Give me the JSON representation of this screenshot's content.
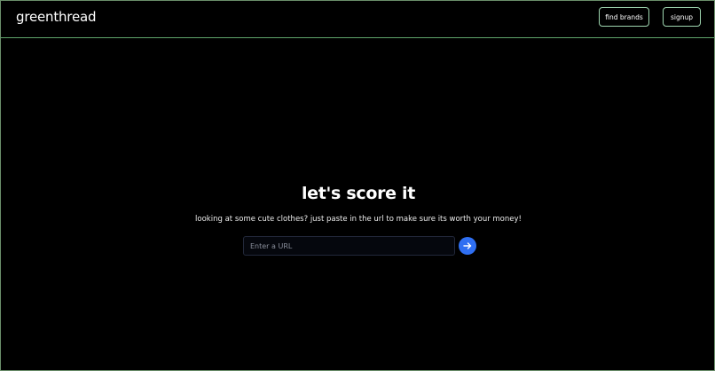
{
  "header": {
    "logo": "greenthread",
    "nav": {
      "find_brands": "find brands",
      "signup": "signup"
    }
  },
  "hero": {
    "title": "let's score it",
    "subtitle": "looking at some cute clothes? just paste in the url to make sure its worth your money!",
    "url_input": {
      "value": "",
      "placeholder": "Enter a URL"
    },
    "submit_icon": "arrow-right-icon"
  },
  "colors": {
    "background": "#000000",
    "header_border": "#5fa46b",
    "button_border": "#9fd6b0",
    "submit_accent": "#2f6ff2"
  }
}
